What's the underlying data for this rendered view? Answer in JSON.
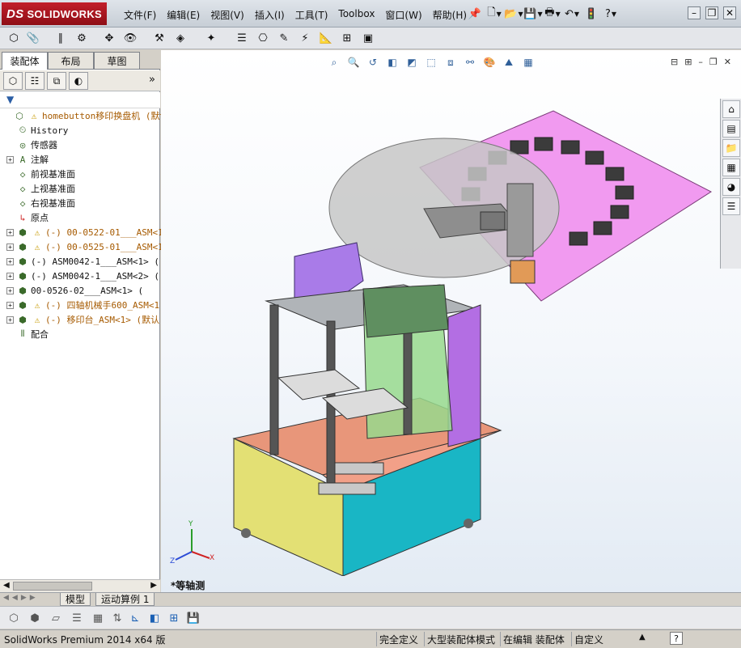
{
  "app": {
    "brand": "SOLIDWORKS",
    "brand_prefix": "DS"
  },
  "menu": [
    "文件(F)",
    "编辑(E)",
    "视图(V)",
    "插入(I)",
    "工具(T)",
    "Toolbox",
    "窗口(W)",
    "帮助(H)"
  ],
  "panel_tabs": [
    "装配体",
    "布局",
    "草图"
  ],
  "tree": [
    {
      "label": "homebutton移印换盘机 (默认",
      "icon": "assembly-icon",
      "warn": true,
      "expandable": false
    },
    {
      "label": "History",
      "icon": "history-icon"
    },
    {
      "label": "传感器",
      "icon": "sensor-icon"
    },
    {
      "label": "注解",
      "icon": "annotation-icon",
      "expandable": true
    },
    {
      "label": "前视基准面",
      "icon": "plane-icon"
    },
    {
      "label": "上视基准面",
      "icon": "plane-icon"
    },
    {
      "label": "右视基准面",
      "icon": "plane-icon"
    },
    {
      "label": "原点",
      "icon": "origin-icon"
    },
    {
      "label": "(-) 00-0522-01___ASM<1>",
      "icon": "subassembly-icon",
      "warn": true,
      "expandable": true
    },
    {
      "label": "(-) 00-0525-01___ASM<1>",
      "icon": "subassembly-icon",
      "warn": true,
      "expandable": true
    },
    {
      "label": "(-) ASM0042-1___ASM<1> (",
      "icon": "subassembly-icon",
      "expandable": true
    },
    {
      "label": "(-) ASM0042-1___ASM<2> (",
      "icon": "subassembly-icon",
      "expandable": true
    },
    {
      "label": "00-0526-02___ASM<1> (",
      "icon": "subassembly-icon",
      "expandable": true
    },
    {
      "label": "(-) 四轴机械手600_ASM<1",
      "icon": "subassembly-icon",
      "warn": true,
      "expandable": true
    },
    {
      "label": "(-) 移印台_ASM<1> (默认",
      "icon": "subassembly-icon",
      "warn": true,
      "expandable": true
    },
    {
      "label": "配合",
      "icon": "mates-icon"
    }
  ],
  "viewport": {
    "view_label": "*等轴测"
  },
  "triad": {
    "x": "X",
    "y": "Y",
    "z": "Z"
  },
  "bottom_tabs": [
    "模型",
    "运动算例 1"
  ],
  "status": {
    "app_version": "SolidWorks Premium 2014 x64 版",
    "state": "完全定义",
    "mode": "大型装配体模式",
    "editing": "在编辑 装配体",
    "units": "自定义"
  },
  "colors": {
    "menu_bg": "#d4d0c8",
    "brand_red": "#c21f2a",
    "tree_warn": "#c79a00"
  }
}
